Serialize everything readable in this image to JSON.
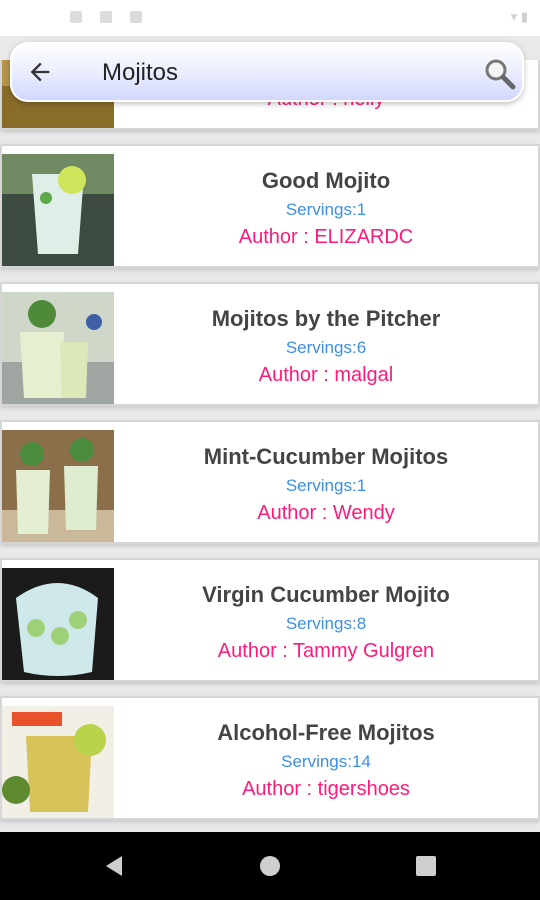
{
  "search": {
    "query": "Mojitos"
  },
  "recipes": [
    {
      "title": "",
      "servings": "",
      "author": "Author : nelly"
    },
    {
      "title": "Good Mojito",
      "servings": "Servings:1",
      "author": "Author : ELIZARDC"
    },
    {
      "title": "Mojitos by the Pitcher",
      "servings": "Servings:6",
      "author": "Author : malgal"
    },
    {
      "title": "Mint-Cucumber Mojitos",
      "servings": "Servings:1",
      "author": "Author : Wendy"
    },
    {
      "title": "Virgin Cucumber Mojito",
      "servings": "Servings:8",
      "author": "Author : Tammy Gulgren"
    },
    {
      "title": "Alcohol-Free Mojitos",
      "servings": "Servings:14",
      "author": "Author : tigershoes"
    }
  ],
  "colors": {
    "servings": "#3b8fe6",
    "author": "#ff1a7a",
    "title": "#444444"
  },
  "icons": {
    "back": "arrow-left-icon",
    "search": "magnifier-icon",
    "nav_back": "triangle-back-icon",
    "nav_home": "circle-home-icon",
    "nav_recents": "square-recents-icon"
  }
}
